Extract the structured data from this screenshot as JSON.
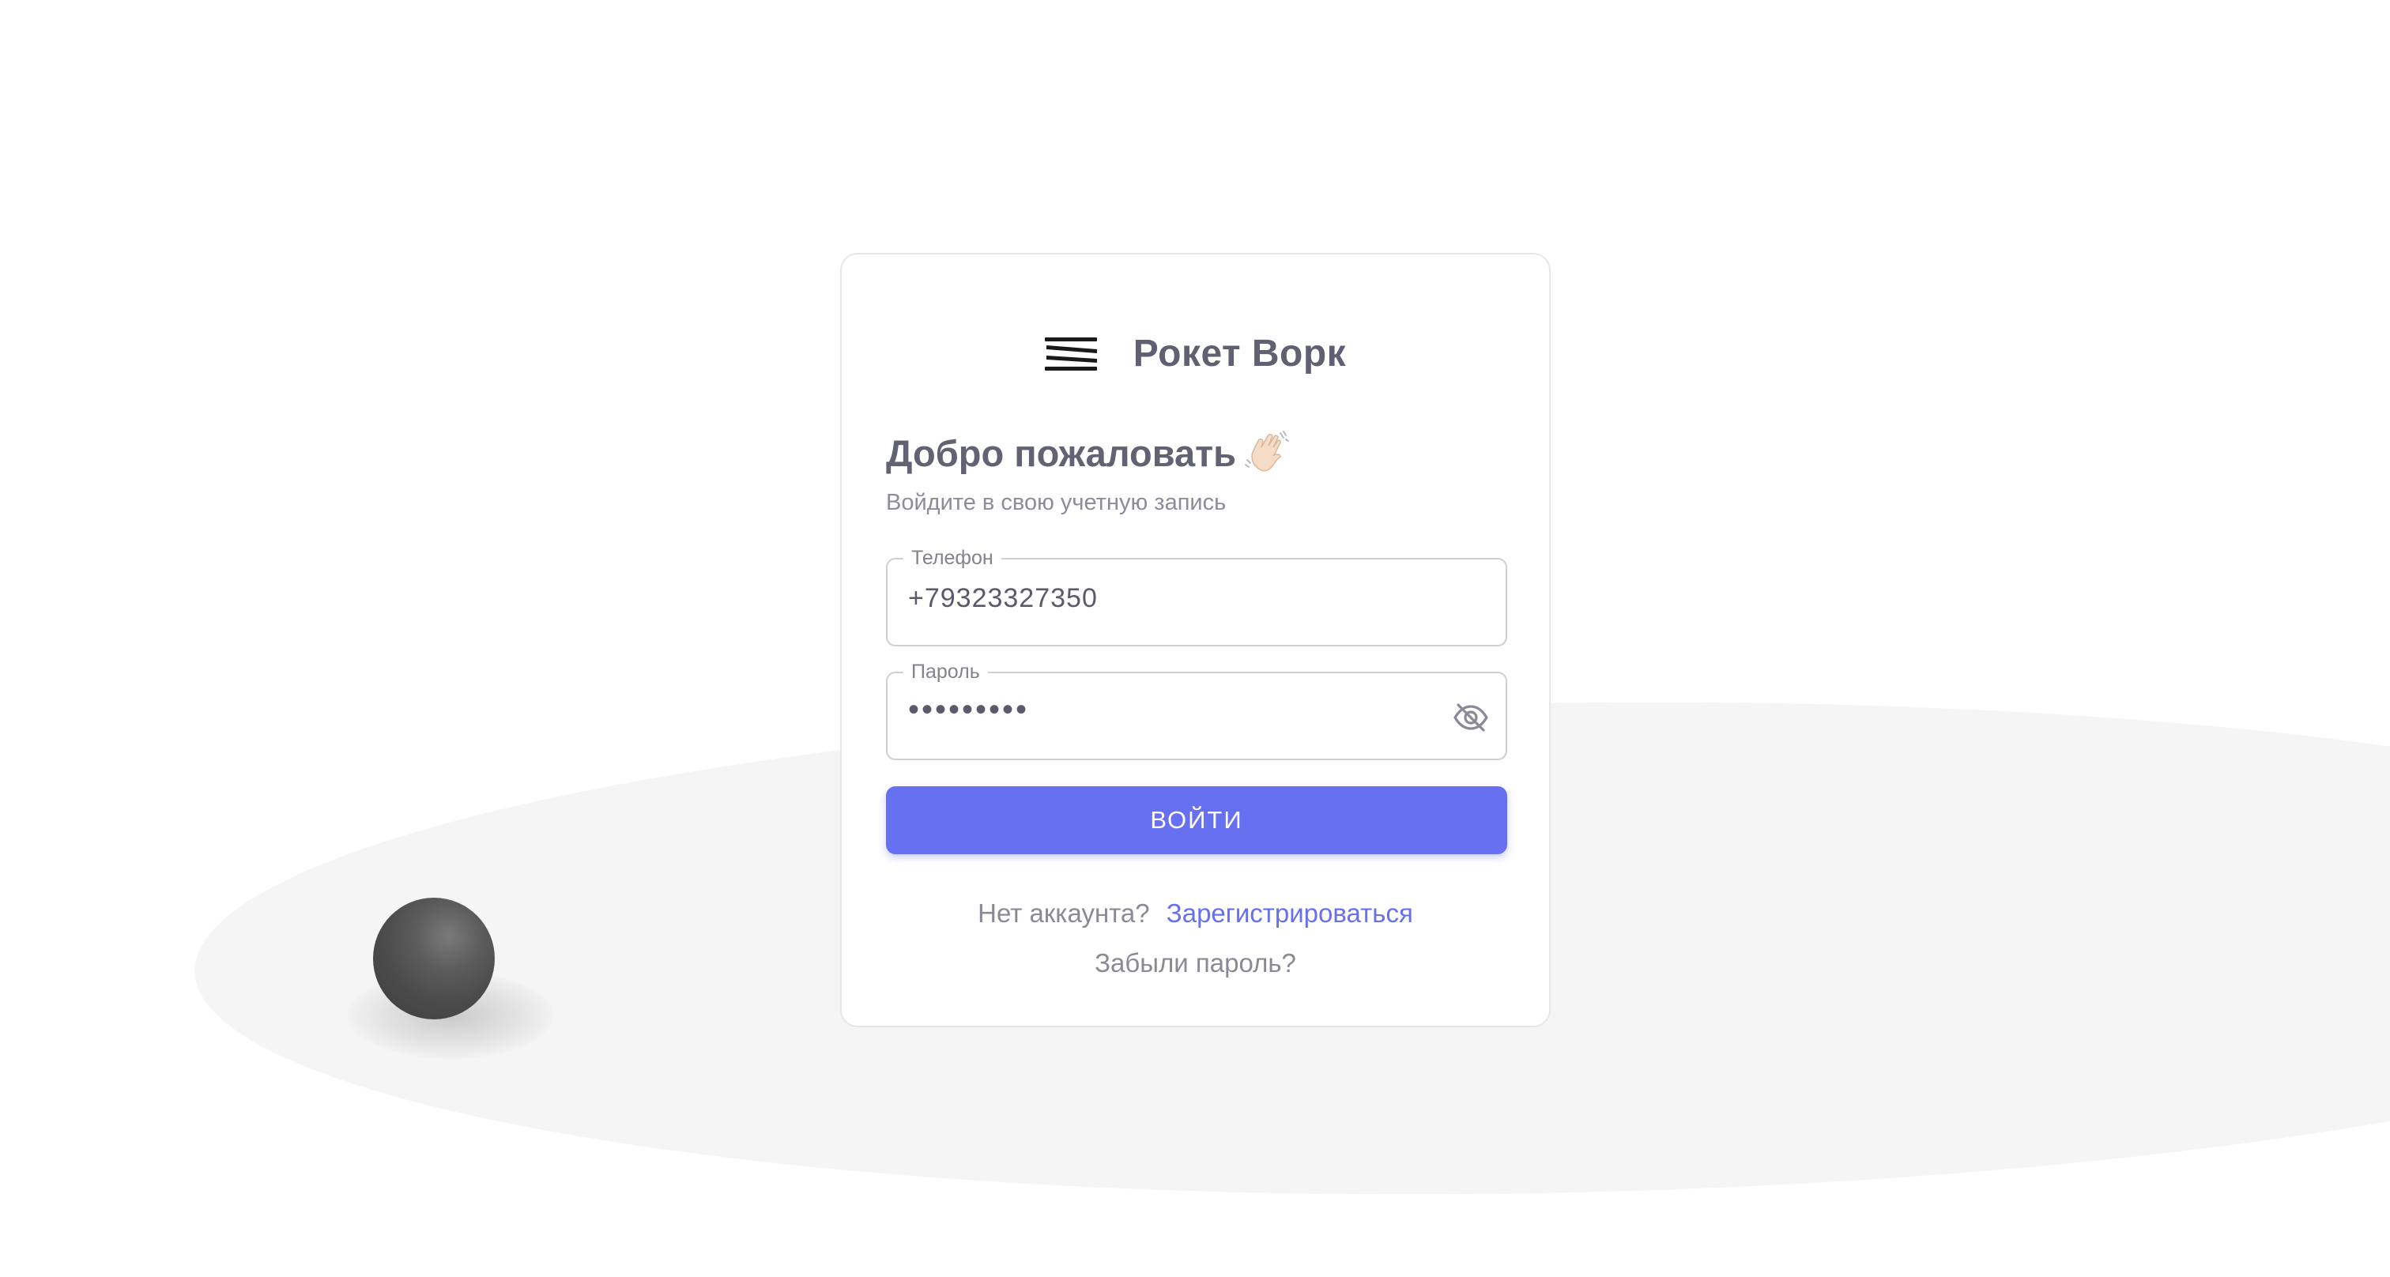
{
  "brand": {
    "name": "Рокет Ворк",
    "logo_icon": "stacked-lines-logo-icon"
  },
  "login": {
    "title": "Добро пожаловать",
    "title_icon": "waving-hand-icon",
    "subtitle": "Войдите в свою учетную запись",
    "phone": {
      "label": "Телефон",
      "value": "+79323327350"
    },
    "password": {
      "label": "Пароль",
      "value": "•••••••••",
      "toggle_icon": "eye-off-icon"
    },
    "submit_label": "ВОЙТИ",
    "register_prompt": "Нет аккаунта?",
    "register_link": "Зарегистрироваться",
    "forgot_link": "Забыли пароль?"
  },
  "colors": {
    "accent": "#6870f2",
    "text_dark": "#5f6071",
    "text_muted": "#8a8a96",
    "background_shape": "#f5f5f5"
  }
}
